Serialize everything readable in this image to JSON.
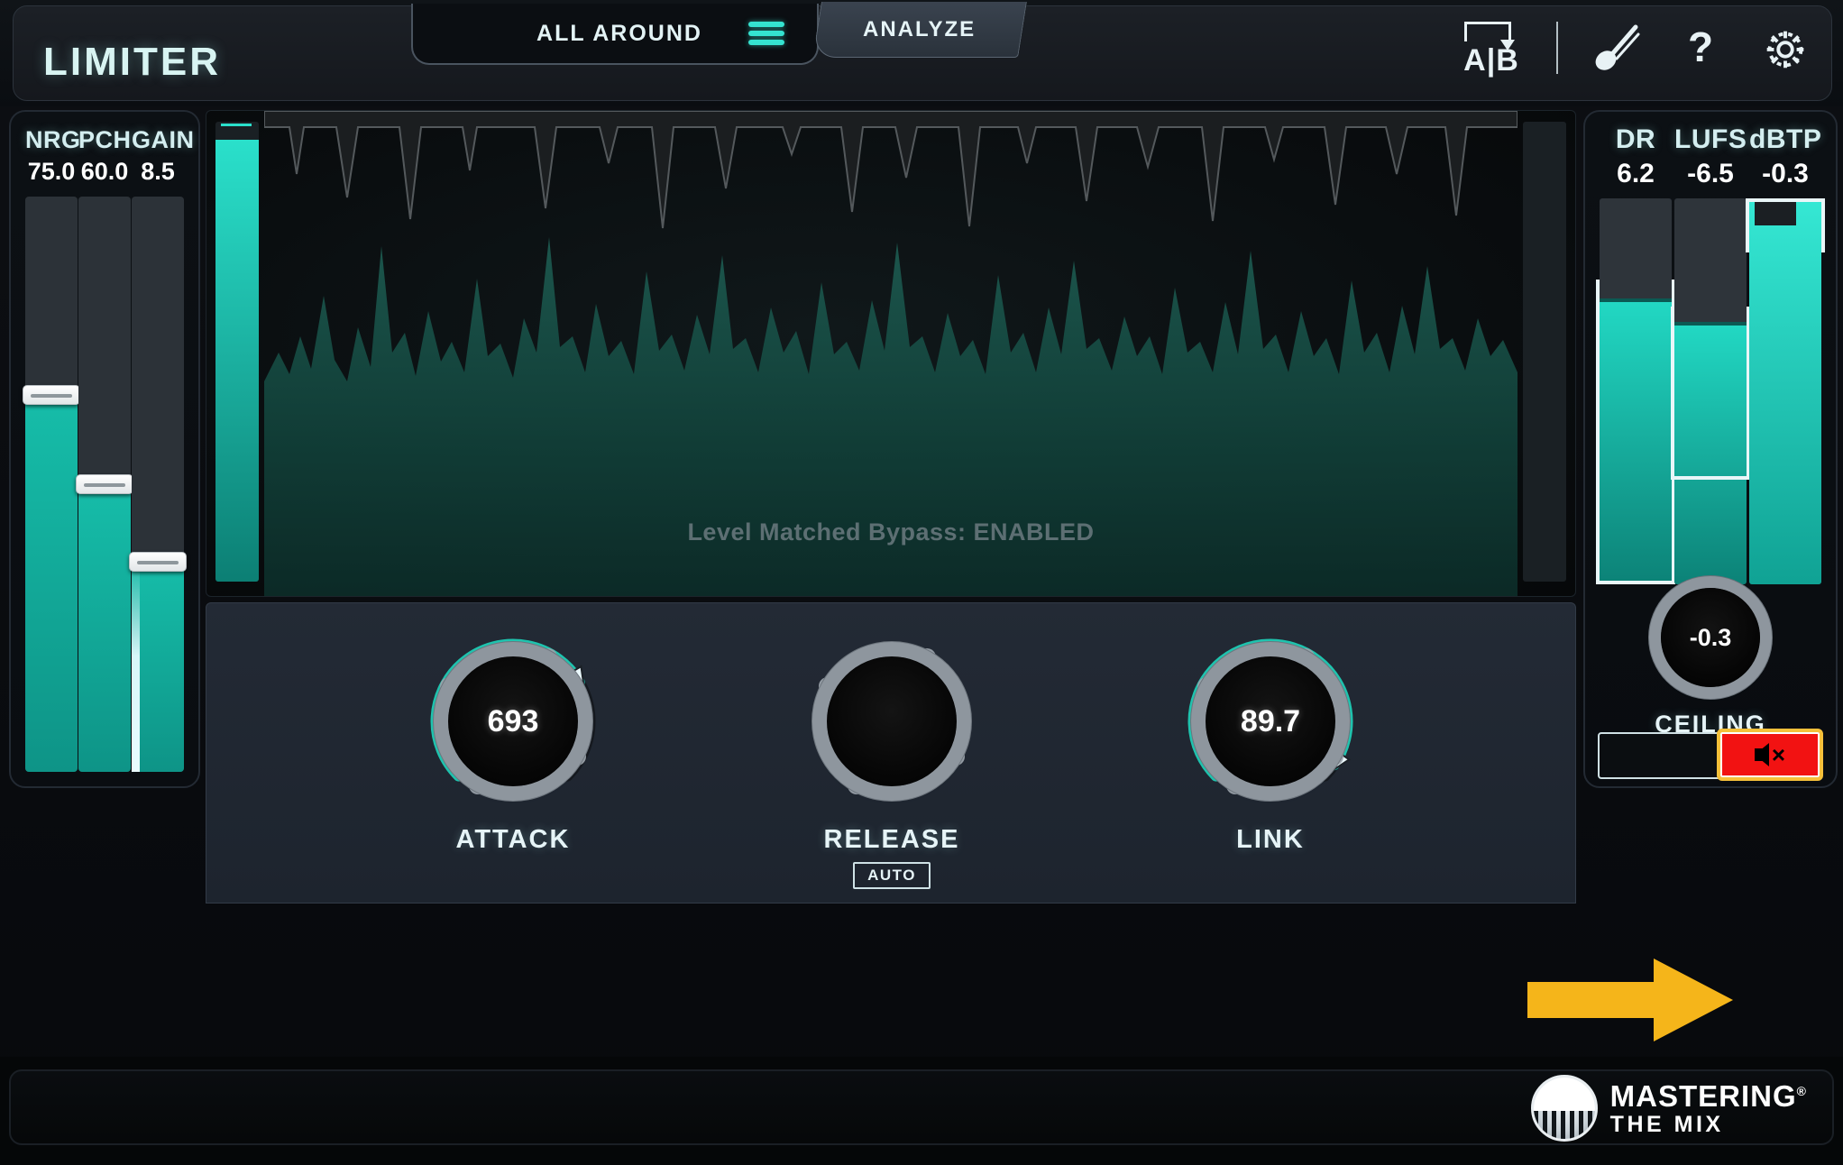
{
  "header": {
    "title": "LIMITER",
    "preset_tab": "ALL AROUND",
    "preset_menu_icon": "hamburger-menu-icon",
    "analyze_tab": "ANALYZE",
    "icons": {
      "ab_a": "A",
      "ab_b": "B",
      "ab_name": "ab-compare-icon",
      "wand_name": "magic-wand-icon",
      "help": "?",
      "settings_name": "gear-icon"
    }
  },
  "left_meters": {
    "items": [
      {
        "name": "NRG",
        "value": "75.0",
        "fill_pct": 65.5,
        "handle_pct": 65.5
      },
      {
        "name": "PCH",
        "value": "60.0",
        "fill_pct": 50.0,
        "handle_pct": 50.0
      },
      {
        "name": "GAIN",
        "value": "8.5",
        "fill_pct": 36.5,
        "handle_pct": 36.5
      }
    ]
  },
  "waveform": {
    "bypass_message": "Level Matched Bypass: ENABLED",
    "left_meter_fill_pct": 96
  },
  "knobs": [
    {
      "id": "attack",
      "label": "ATTACK",
      "value": "693",
      "arc_pct": 72,
      "show_value": true,
      "badge": ""
    },
    {
      "id": "release",
      "label": "RELEASE",
      "value": "",
      "arc_pct": 0,
      "show_value": false,
      "badge": "AUTO"
    },
    {
      "id": "link",
      "label": "LINK",
      "value": "89.7",
      "arc_pct": 96,
      "show_value": true,
      "badge": ""
    }
  ],
  "right_meters": {
    "items": [
      {
        "name": "DR",
        "value": "6.2",
        "fill_pct": 74,
        "bracket_top_pct": 79,
        "bracket_bottom_pct": 0,
        "bright": false
      },
      {
        "name": "LUFS",
        "value": "-6.5",
        "fill_pct": 68,
        "bracket_top_pct": 72,
        "bracket_bottom_pct": 27,
        "bright": false
      },
      {
        "name": "dBTP",
        "value": "-0.3",
        "fill_pct": 100,
        "bracket_top_pct": 100,
        "bracket_bottom_pct": 86,
        "bright": true
      }
    ]
  },
  "ceiling": {
    "value": "-0.3",
    "label": "CEILING",
    "arc_pct": 98
  },
  "buttons": {
    "bypass_name": "bypass-button",
    "mute_name": "mute-button",
    "mute_icon": "speaker-muted-icon",
    "mute_state": "active"
  },
  "annotation": {
    "arrow_name": "highlight-arrow",
    "arrow_color": "#f5b51a",
    "highlight_color": "#f5c03a"
  },
  "branding": {
    "line1": "MASTERING",
    "line1_sup": "®",
    "line2": "THE MIX"
  },
  "colors": {
    "accent_teal": "#22d9c4",
    "accent_cyan": "#35e3d0",
    "text_light": "#e6f4f7",
    "panel_bg": "#0c1014",
    "knob_panel_bg": "#232a35",
    "mute_red": "#f21212",
    "arrow_gold": "#f5b51a"
  }
}
